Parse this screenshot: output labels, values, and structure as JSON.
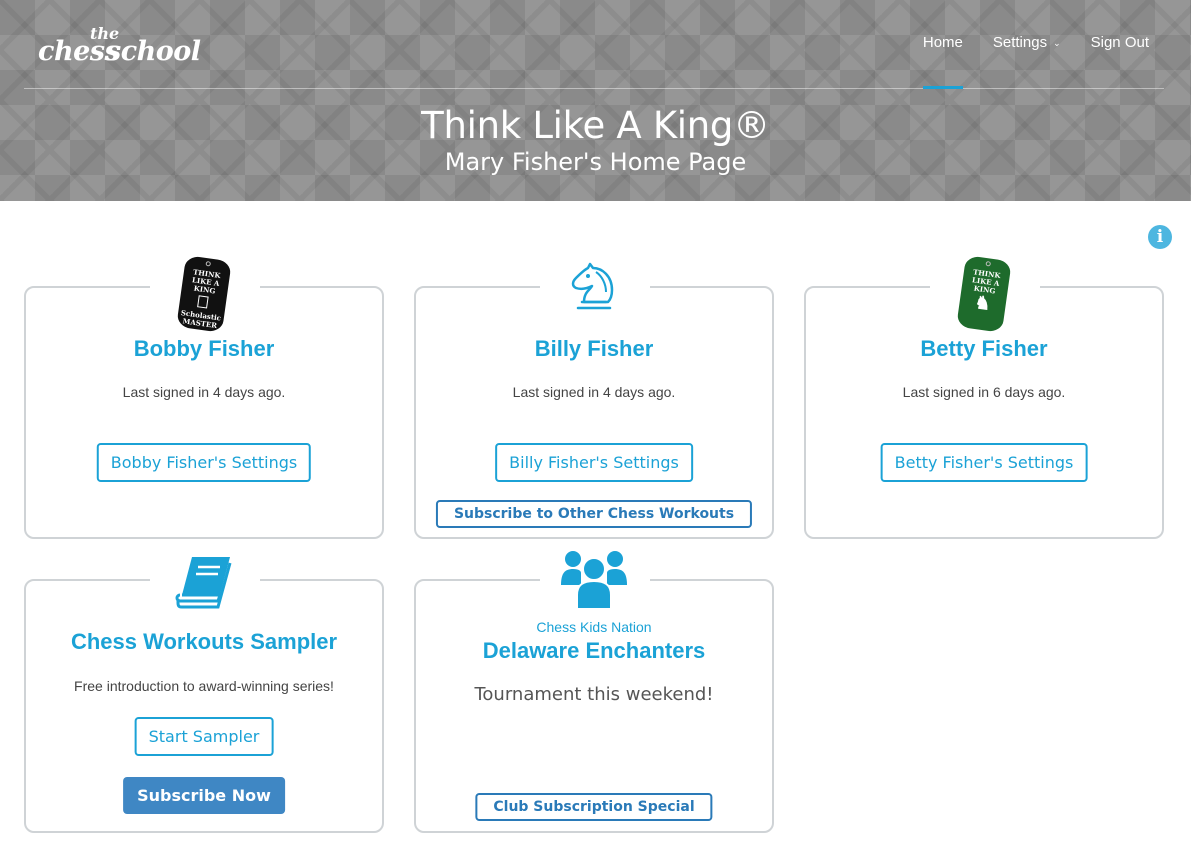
{
  "header": {
    "logo_the": "the",
    "logo_chess": "chess",
    "logo_school": "school",
    "nav": {
      "home": "Home",
      "settings": "Settings",
      "sign_out": "Sign Out"
    },
    "title": "Think Like A King®",
    "subtitle": "Mary Fisher's Home Page"
  },
  "colors": {
    "accent": "#1ba2d6",
    "button_solid": "#3f87c4",
    "card_border": "#cfd3d6"
  },
  "cards": [
    {
      "icon": "scholastic-master-tag-icon",
      "tag_text": "THINK LIKE A KING Scholastic MASTER",
      "name": "Bobby Fisher",
      "status": "Last signed in 4 days ago.",
      "settings_button": "Bobby Fisher's Settings"
    },
    {
      "icon": "knight-icon",
      "name": "Billy Fisher",
      "status": "Last signed in 4 days ago.",
      "settings_button": "Billy Fisher's Settings",
      "subscribe_button": "Subscribe to Other Chess Workouts"
    },
    {
      "icon": "green-king-tag-icon",
      "tag_text": "THINK LIKE A KING",
      "name": "Betty Fisher",
      "status": "Last signed in 6 days ago.",
      "settings_button": "Betty Fisher's Settings"
    },
    {
      "icon": "book-icon",
      "name": "Chess Workouts Sampler",
      "status": "Free introduction to award-winning series!",
      "start_button": "Start Sampler",
      "subscribe_button": "Subscribe Now"
    },
    {
      "icon": "group-icon",
      "org": "Chess Kids Nation",
      "name": "Delaware Enchanters",
      "status": "Tournament this weekend!",
      "special_button": "Club Subscription Special"
    }
  ]
}
